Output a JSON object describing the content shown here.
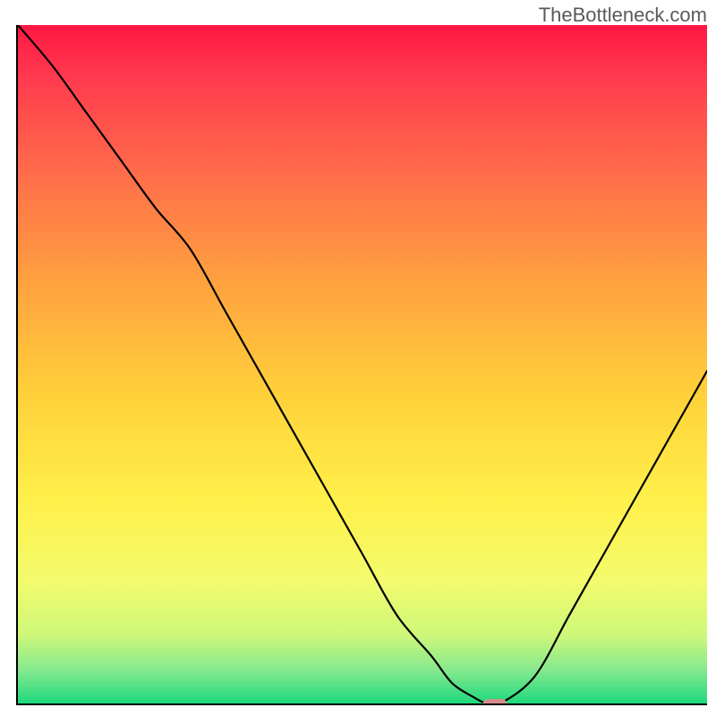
{
  "watermark": "TheBottleneck.com",
  "chart_data": {
    "type": "line",
    "title": "",
    "xlabel": "",
    "ylabel": "",
    "xlim": [
      0,
      100
    ],
    "ylim": [
      0,
      100
    ],
    "x": [
      0,
      5,
      10,
      15,
      20,
      25,
      30,
      35,
      40,
      45,
      50,
      55,
      60,
      63,
      66,
      68,
      70,
      75,
      80,
      85,
      90,
      95,
      100
    ],
    "values": [
      100,
      94,
      87,
      80,
      73,
      67,
      58,
      49,
      40,
      31,
      22,
      13,
      7,
      3,
      1,
      0,
      0,
      4,
      13,
      22,
      31,
      40,
      49
    ],
    "marker": {
      "x": 69,
      "y": 0
    },
    "gradient_stops": [
      {
        "offset": 0,
        "color": "#ff1744"
      },
      {
        "offset": 0.08,
        "color": "#ff3b4e"
      },
      {
        "offset": 0.22,
        "color": "#ff6d4a"
      },
      {
        "offset": 0.38,
        "color": "#ffa23f"
      },
      {
        "offset": 0.55,
        "color": "#ffd23a"
      },
      {
        "offset": 0.7,
        "color": "#fff04a"
      },
      {
        "offset": 0.82,
        "color": "#f3fb6d"
      },
      {
        "offset": 0.9,
        "color": "#cdf77a"
      },
      {
        "offset": 0.95,
        "color": "#87e98e"
      },
      {
        "offset": 1.0,
        "color": "#1ed97c"
      }
    ]
  }
}
